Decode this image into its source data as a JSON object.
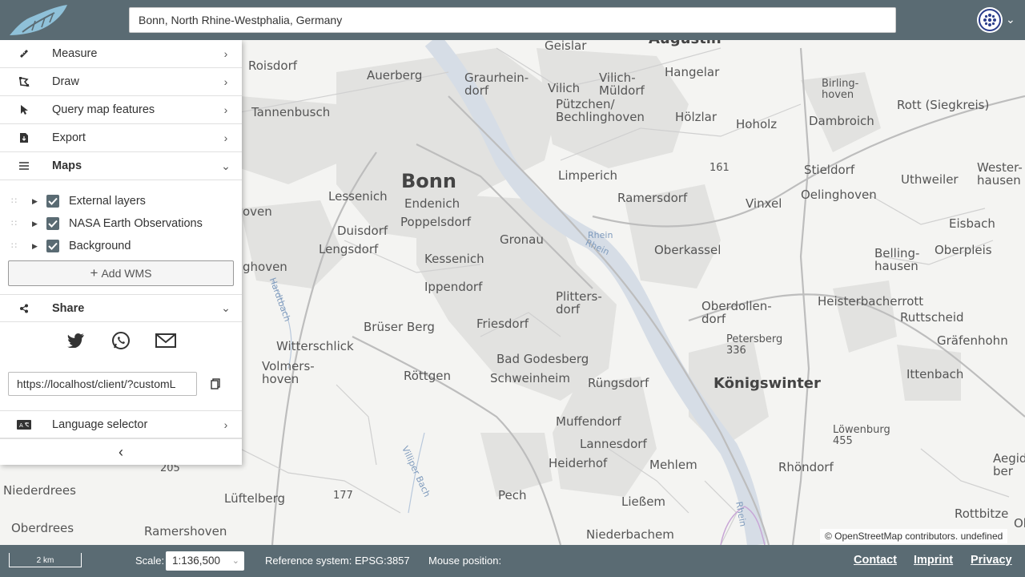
{
  "search": {
    "value": "Bonn, North Rhine-Westphalia, Germany"
  },
  "sidebar": {
    "tools": [
      {
        "label": "Measure",
        "icon": "ruler-icon"
      },
      {
        "label": "Draw",
        "icon": "draw-polygon-icon"
      },
      {
        "label": "Query map features",
        "icon": "cursor-icon"
      },
      {
        "label": "Export",
        "icon": "file-export-icon"
      }
    ],
    "maps": {
      "label": "Maps",
      "icon": "list-icon"
    },
    "layers": [
      {
        "label": "External layers",
        "checked": true
      },
      {
        "label": "NASA Earth Observations",
        "checked": true
      },
      {
        "label": "Background",
        "checked": true
      }
    ],
    "add_wms": "Add WMS",
    "share": {
      "label": "Share",
      "url": "https://localhost/client/?customL"
    },
    "language": {
      "label": "Language selector"
    }
  },
  "map": {
    "places": [
      {
        "t": "Augustin",
        "c": "mid"
      },
      {
        "t": "Geislar"
      },
      {
        "t": "Roisdorf"
      },
      {
        "t": "Auerberg"
      },
      {
        "t": "Graurhein-\ndorf"
      },
      {
        "t": "Vilich"
      },
      {
        "t": "Vilich-\nMüldorf"
      },
      {
        "t": "Hangelar"
      },
      {
        "t": "Birling-\nhoven",
        "c": "small"
      },
      {
        "t": "Rott (Siegkreis)"
      },
      {
        "t": "Tannenbusch"
      },
      {
        "t": "Pützchen/\nBechlinghoven"
      },
      {
        "t": "Hölzlar"
      },
      {
        "t": "Hoholz"
      },
      {
        "t": "Dambroich"
      },
      {
        "t": "Bonn",
        "c": "big"
      },
      {
        "t": "Limperich"
      },
      {
        "t": "161",
        "c": "small"
      },
      {
        "t": "Stieldorf"
      },
      {
        "t": "Wester-\nhausen"
      },
      {
        "t": "Lessenich"
      },
      {
        "t": "Endenich"
      },
      {
        "t": "Ramersdorf"
      },
      {
        "t": "Oelinghoven"
      },
      {
        "t": "Uthweiler"
      },
      {
        "t": "Poppelsdorf"
      },
      {
        "t": "Vinxel"
      },
      {
        "t": "Eisbach"
      },
      {
        "t": "Duisdorf"
      },
      {
        "t": "Gronau"
      },
      {
        "t": "Rhein",
        "c": "water"
      },
      {
        "t": "Lengsdorf"
      },
      {
        "t": "Oberkassel"
      },
      {
        "t": "Belling-\nhausen"
      },
      {
        "t": "Oberpleis"
      },
      {
        "t": "Kessenich"
      },
      {
        "t": "Ippendorf"
      },
      {
        "t": "Heisterbacherrott"
      },
      {
        "t": "Plitters-\ndorf"
      },
      {
        "t": "Oberdollen-\ndorf"
      },
      {
        "t": "Ruttscheid"
      },
      {
        "t": "Brüser Berg"
      },
      {
        "t": "Friesdorf"
      },
      {
        "t": "Petersberg\n336",
        "c": "small"
      },
      {
        "t": "Gräfenhohn"
      },
      {
        "t": "Witterschlick"
      },
      {
        "t": "Bad Godesberg"
      },
      {
        "t": "Volmers-\nhoven"
      },
      {
        "t": "Röttgen"
      },
      {
        "t": "Schweinheim"
      },
      {
        "t": "Rüngsdorf"
      },
      {
        "t": "Königswinter",
        "c": "mid"
      },
      {
        "t": "Ittenbach"
      },
      {
        "t": "Löwenburg\n455",
        "c": "small"
      },
      {
        "t": "Muffendorf"
      },
      {
        "t": "Lannesdorf"
      },
      {
        "t": "Rhöndorf"
      },
      {
        "t": "Heiderhof"
      },
      {
        "t": "Mehlem"
      },
      {
        "t": "Aegid-\nber"
      },
      {
        "t": "Niederdrees"
      },
      {
        "t": "177",
        "c": "small"
      },
      {
        "t": "Lüftelberg"
      },
      {
        "t": "Pech"
      },
      {
        "t": "Ließem"
      },
      {
        "t": "Rottbitze"
      },
      {
        "t": "Oberdrees"
      },
      {
        "t": "Ramershoven"
      },
      {
        "t": "Niederbachem"
      },
      {
        "t": "Villiper Bach",
        "c": "water"
      },
      {
        "t": "Hardtbach",
        "c": "water"
      },
      {
        "t": "Rhein",
        "c": "water"
      },
      {
        "t": "Rhein",
        "c": "water"
      },
      {
        "t": "Ober"
      },
      {
        "t": "oven"
      },
      {
        "t": "ghoven"
      },
      {
        "t": "205",
        "c": "small"
      }
    ]
  },
  "attribution": "© OpenStreetMap contributors. undefined",
  "footer": {
    "scalebar": "2 km",
    "scale_label": "Scale:",
    "scale_value": "1:136,500",
    "refsys": "Reference system: EPSG:3857",
    "mousepos": "Mouse position:",
    "links": [
      "Contact",
      "Imprint",
      "Privacy"
    ]
  },
  "colors": {
    "header": "#5a6b73",
    "checkbox": "#5a6b73",
    "map_bg": "#f4f4f2",
    "water": "#d6dde6"
  }
}
